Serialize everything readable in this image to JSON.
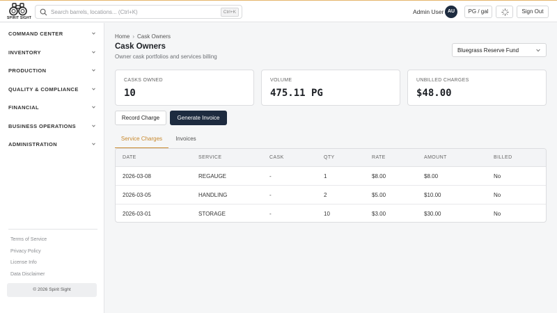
{
  "app": {
    "logo_text": "SPIRIT SIGHT"
  },
  "search": {
    "placeholder": "Search barrels, locations... (Ctrl+K)",
    "shortcut": "Ctrl+K"
  },
  "user": {
    "name": "Admin User",
    "initials": "AU"
  },
  "header_actions": {
    "unit_toggle": "PG / gal",
    "loading_icon": "spinner-icon",
    "sign_out": "Sign Out"
  },
  "sidebar": {
    "items": [
      {
        "label": "COMMAND CENTER"
      },
      {
        "label": "INVENTORY"
      },
      {
        "label": "PRODUCTION"
      },
      {
        "label": "QUALITY & COMPLIANCE"
      },
      {
        "label": "FINANCIAL"
      },
      {
        "label": "BUSINESS OPERATIONS"
      },
      {
        "label": "ADMINISTRATION"
      }
    ],
    "footer_links": [
      "Terms of Service",
      "Privacy Policy",
      "License Info",
      "Data Disclaimer"
    ],
    "copyright": "© 2026 Spirit Sight"
  },
  "breadcrumb": {
    "home": "Home",
    "separator": "›",
    "current": "Cask Owners"
  },
  "page": {
    "title": "Cask Owners",
    "subtitle": "Owner cask portfolios and services billing"
  },
  "fund_select": {
    "value": "Bluegrass Reserve Fund"
  },
  "stats": [
    {
      "label": "CASKS OWNED",
      "value": "10"
    },
    {
      "label": "VOLUME",
      "value": "475.11 PG"
    },
    {
      "label": "UNBILLED CHARGES",
      "value": "$48.00"
    }
  ],
  "actions": {
    "record_charge": "Record Charge",
    "generate_invoice": "Generate Invoice"
  },
  "tabs": [
    {
      "label": "Service Charges",
      "active": true
    },
    {
      "label": "Invoices",
      "active": false
    }
  ],
  "table": {
    "columns": [
      "DATE",
      "SERVICE",
      "CASK",
      "QTY",
      "RATE",
      "AMOUNT",
      "BILLED"
    ],
    "rows": [
      [
        "2026-03-08",
        "REGAUGE",
        "-",
        "1",
        "$8.00",
        "$8.00",
        "No"
      ],
      [
        "2026-03-05",
        "HANDLING",
        "-",
        "2",
        "$5.00",
        "$10.00",
        "No"
      ],
      [
        "2026-03-01",
        "STORAGE",
        "-",
        "10",
        "$3.00",
        "$30.00",
        "No"
      ]
    ]
  },
  "colors": {
    "accent": "#c8892e",
    "primary": "#1d2b3f"
  }
}
